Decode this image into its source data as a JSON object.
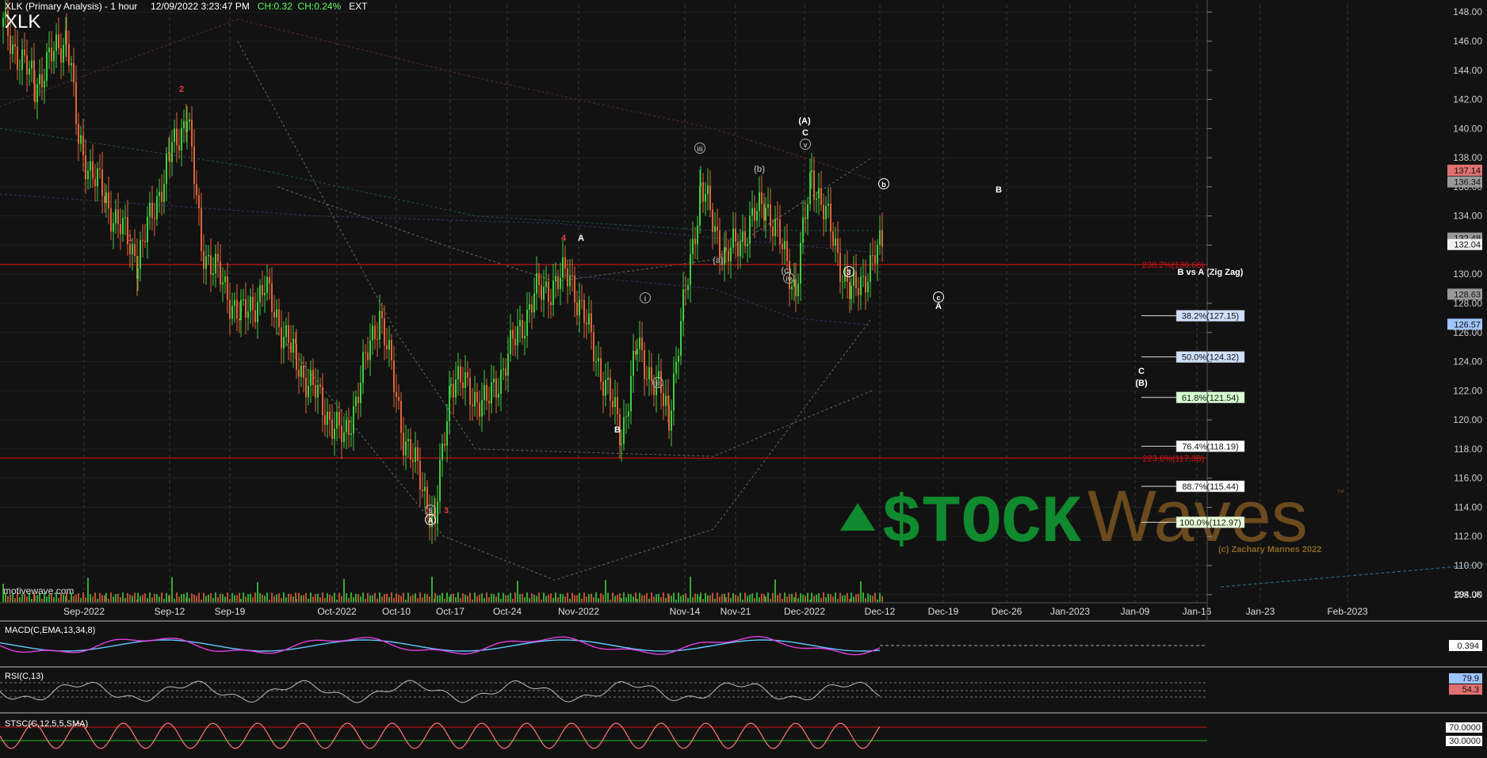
{
  "header": {
    "title": "XLK (Primary Analysis) - 1 hour",
    "datetime": "12/09/2022 3:23:47 PM",
    "change_points": "CH:0.32",
    "change_pct": "CH:0.24%",
    "session": "EXT",
    "symbol": "XLK"
  },
  "watermark_source": "motivewave.com",
  "logo": {
    "stock": "$TOCK",
    "waves": "Waves",
    "tm": "™",
    "copyright": "(c) Zachary Mannes 2022"
  },
  "colors": {
    "background": "#121212",
    "up_candle": "#3ecf3e",
    "down_candle": "#e0643a",
    "hline": "#d01515",
    "grid": "#3a3a3a",
    "macd": "#e040e0",
    "macd_signal": "#60c8ff",
    "rsi": "#bbbbbb",
    "stoch": "#ff7777",
    "logo_green": "#0f8a2e",
    "logo_brown": "#6b4a1e"
  },
  "chart_data": {
    "type": "candlestick",
    "price_axis": {
      "ylim": [
        107.5,
        148.5
      ],
      "ticks": [
        "148.00",
        "146.00",
        "144.00",
        "142.00",
        "140.00",
        "138.00",
        "136.00",
        "134.00",
        "132.00",
        "130.00",
        "128.00",
        "126.00",
        "124.00",
        "122.00",
        "120.00",
        "118.00",
        "116.00",
        "114.00",
        "112.00",
        "110.00",
        "108.00"
      ]
    },
    "volume_label": "294.0K",
    "x_axis": {
      "ticks": [
        "Sep-2022",
        "Sep-12",
        "Sep-19",
        "Oct-2022",
        "Oct-10",
        "Oct-17",
        "Oct-24",
        "Nov-2022",
        "Nov-14",
        "Nov-21",
        "Dec-2022",
        "Dec-12",
        "Dec-19",
        "Dec-26",
        "Jan-2023",
        "Jan-09",
        "Jan-16",
        "Jan-23",
        "Feb-2023"
      ]
    },
    "price_markers": [
      {
        "label": "137.14",
        "value": 137.14,
        "color": "#e07070"
      },
      {
        "label": "136.34",
        "value": 136.34,
        "color": "#999999"
      },
      {
        "label": "132.48",
        "value": 132.48,
        "color": "#999999"
      },
      {
        "label": "132.04",
        "value": 132.04,
        "color": "#f0f0f0"
      },
      {
        "label": "128.63",
        "value": 128.63,
        "color": "#999999"
      },
      {
        "label": "126.57",
        "value": 126.57,
        "color": "#9fc4ff"
      }
    ],
    "horizontal_lines": [
      {
        "label": "238.2%(130.66)",
        "value": 130.66
      },
      {
        "label": "223.6%(117.38)",
        "value": 117.38
      }
    ],
    "fib_title": "B vs A (Zig Zag)",
    "fib_levels": [
      {
        "label": "38.2%(127.15)",
        "value": 127.15,
        "color": "#cfe0ff"
      },
      {
        "label": "50.0%(124.32)",
        "value": 124.32,
        "color": "#cfe0ff"
      },
      {
        "label": "61.8%(121.54)",
        "value": 121.54,
        "color": "#d8ffd0"
      },
      {
        "label": "76.4%(118.19)",
        "value": 118.19,
        "color": "#ffffff"
      },
      {
        "label": "88.7%(115.44)",
        "value": 115.44,
        "color": "#ffffff"
      },
      {
        "label": "100.0%(112.97)",
        "value": 112.97,
        "color": "#e8ffd8"
      }
    ],
    "wave_labels": [
      {
        "text": "2",
        "color": "#e04040",
        "circle": false
      },
      {
        "text": "1",
        "color": "#e04040",
        "circle": false
      },
      {
        "text": "4",
        "color": "#e04040",
        "circle": false
      },
      {
        "text": "A",
        "color": "#ffffff",
        "circle": false
      },
      {
        "text": "B",
        "color": "#ffffff",
        "circle": false
      },
      {
        "text": "5",
        "color": "#aaaaaa",
        "circle": true
      },
      {
        "text": "3",
        "color": "#e04040",
        "circle": false
      },
      {
        "text": "A",
        "color": "#ffffff",
        "circle": true
      },
      {
        "text": "i",
        "color": "#aaaaaa",
        "circle": true
      },
      {
        "text": "ii",
        "color": "#aaaaaa",
        "circle": true
      },
      {
        "text": "iii",
        "color": "#aaaaaa",
        "circle": true
      },
      {
        "text": "(a)",
        "color": "#999999",
        "circle": false
      },
      {
        "text": "(b)",
        "color": "#999999",
        "circle": false
      },
      {
        "text": "(c)",
        "color": "#999999",
        "circle": false
      },
      {
        "text": "iv",
        "color": "#aaaaaa",
        "circle": true
      },
      {
        "text": "(A)",
        "color": "#ffffff",
        "circle": false
      },
      {
        "text": "C",
        "color": "#ffffff",
        "circle": false
      },
      {
        "text": "v",
        "color": "#aaaaaa",
        "circle": true
      },
      {
        "text": "3",
        "color": "#ffffff",
        "circle": true
      },
      {
        "text": "b",
        "color": "#ffffff",
        "circle": true
      },
      {
        "text": "B",
        "color": "#ffffff",
        "circle": false
      },
      {
        "text": "c",
        "color": "#ffffff",
        "circle": true
      },
      {
        "text": "A",
        "color": "#ffffff",
        "circle": false
      },
      {
        "text": "C",
        "color": "#ffffff",
        "circle": false
      },
      {
        "text": "(B)",
        "color": "#ffffff",
        "circle": false
      }
    ],
    "panels": {
      "macd": {
        "label": "MACD(C,EMA,13,34,8)",
        "value": "0.394"
      },
      "rsi": {
        "label": "RSI(C,13)",
        "value_a": "79.9",
        "value_b": "54.3"
      },
      "stoch": {
        "label": "STSC(C,12,5,5,SMA)",
        "upper": "70.0000",
        "lower": "30.0000"
      }
    }
  }
}
